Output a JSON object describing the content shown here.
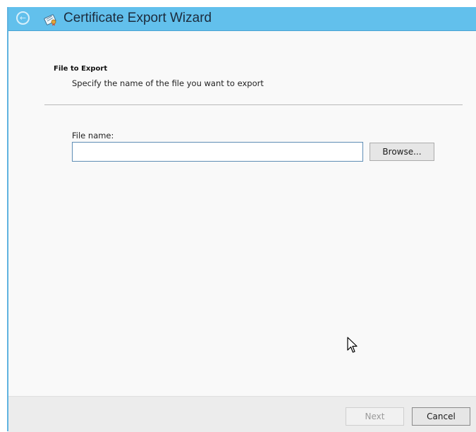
{
  "window": {
    "title": "Certificate Export Wizard",
    "back_icon": "back-arrow-icon",
    "title_icon": "certificate-wizard-icon",
    "accent_color": "#62c0ec"
  },
  "page": {
    "section_title": "File to Export",
    "section_subtitle": "Specify the name of the file you want to export"
  },
  "file_field": {
    "label": "File name:",
    "value": "",
    "browse_label": "Browse..."
  },
  "footer": {
    "next_label": "Next",
    "cancel_label": "Cancel",
    "next_enabled": false
  }
}
